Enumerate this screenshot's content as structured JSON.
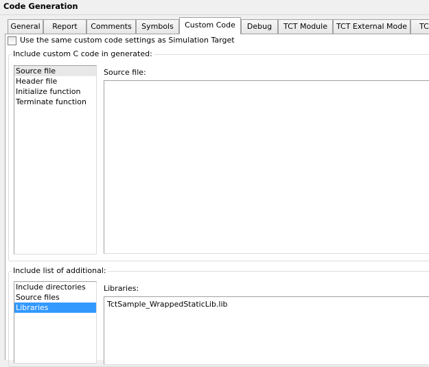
{
  "window": {
    "title": "Code Generation"
  },
  "tabs": [
    {
      "label": "General"
    },
    {
      "label": "Report"
    },
    {
      "label": "Comments"
    },
    {
      "label": "Symbols"
    },
    {
      "label": "Custom Code",
      "active": true
    },
    {
      "label": "Debug"
    },
    {
      "label": "TCT Module"
    },
    {
      "label": "TCT External Mode"
    },
    {
      "label": "TC"
    }
  ],
  "same_settings": {
    "label": "Use the same custom code settings as Simulation Target",
    "checked": false
  },
  "custom_code": {
    "legend": "Include custom C code in generated:",
    "items": [
      "Source file",
      "Header file",
      "Initialize function",
      "Terminate function"
    ],
    "selected": "Source file",
    "editor_label": "Source file:",
    "editor_value": ""
  },
  "additional": {
    "legend": "Include list of additional:",
    "items": [
      "Include directories",
      "Source files",
      "Libraries"
    ],
    "selected": "Libraries",
    "editor_label": "Libraries:",
    "editor_value": "TctSample_WrappedStaticLib.lib"
  },
  "colors": {
    "selection": "#3399ff",
    "panel": "#ffffff",
    "window": "#f0f0f0"
  }
}
